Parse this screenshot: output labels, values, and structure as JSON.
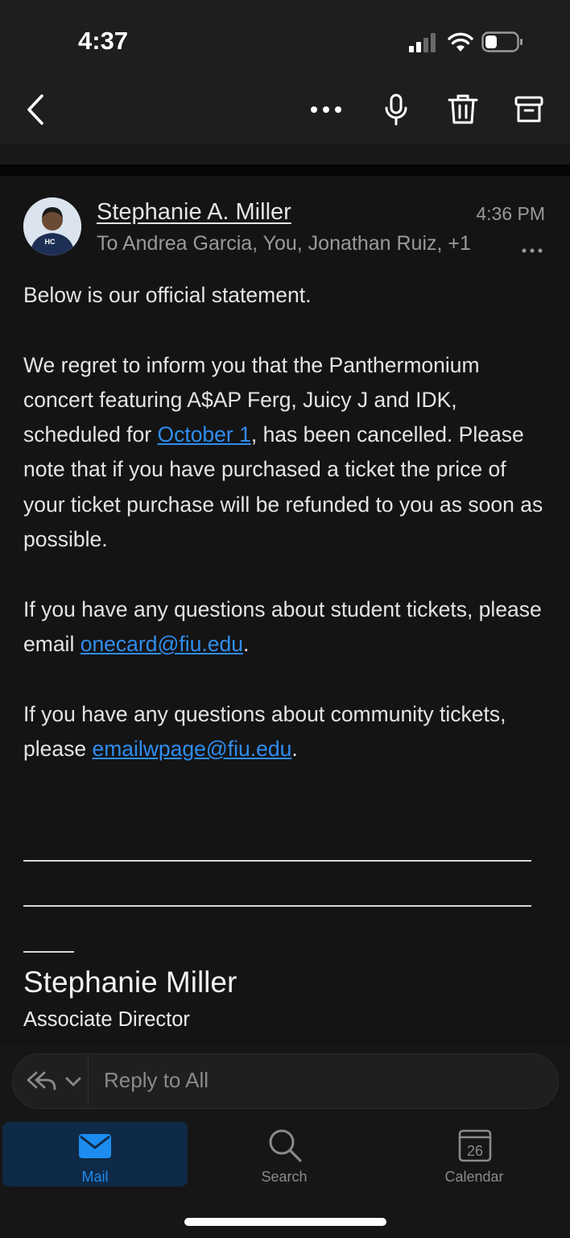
{
  "status_bar": {
    "time": "4:37"
  },
  "toolbar": {
    "back": "chevron-left-icon",
    "more": "more-horizontal-icon",
    "mic": "microphone-icon",
    "delete": "trash-icon",
    "archive": "archive-icon"
  },
  "message": {
    "sender": "Stephanie A. Miller",
    "time": "4:36 PM",
    "recipients": "To Andrea Garcia, You, Jonathan Ruiz, +1",
    "avatar_text": "HC",
    "intro": "Below is our official statement.",
    "p1_before": "We regret to inform you that the Panthermonium concert featuring A$AP Ferg, Juicy J and IDK, scheduled for ",
    "p1_link": "October 1",
    "p1_after": ", has been cancelled. Please note that if you have purchased a ticket the price of your ticket purchase will be refunded to you as soon as possible.",
    "p2_before": "If you have any questions about student tickets, please email ",
    "p2_link": "onecard@fiu.edu",
    "p2_after": ".",
    "p3_before": "If you have any questions about community tickets, please ",
    "p3_link": "emailwpage@fiu.edu",
    "p3_after": ".",
    "signature_name": "Stephanie Miller",
    "signature_title": "Associate Director"
  },
  "reply": {
    "placeholder": "Reply to All"
  },
  "tabs": [
    {
      "label": "Mail",
      "icon": "mail-icon",
      "active": true
    },
    {
      "label": "Search",
      "icon": "search-icon",
      "active": false
    },
    {
      "label": "Calendar",
      "icon": "calendar-icon",
      "active": false,
      "date": "26"
    }
  ],
  "colors": {
    "link": "#2f8df0",
    "active_tab": "#1d8cf0",
    "background": "#141414"
  }
}
